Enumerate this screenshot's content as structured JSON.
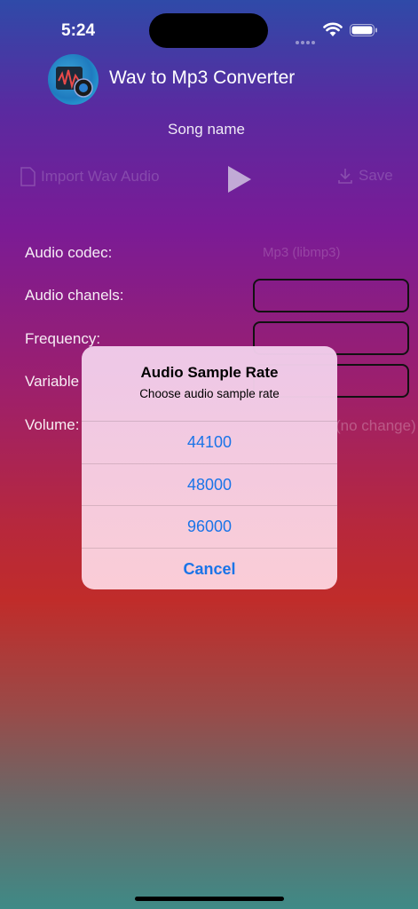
{
  "status": {
    "time": "5:24"
  },
  "header": {
    "title": "Wav to Mp3 Converter"
  },
  "song_name": "Song name",
  "toolbar": {
    "import_label": "Import Wav Audio",
    "save_label": "Save"
  },
  "settings": {
    "codec_label": "Audio codec:",
    "codec_value": "Mp3 (libmp3)",
    "channels_label": "Audio chanels:",
    "frequency_label": "Frequency:",
    "variable_label": "Variable",
    "volume_label": "Volume:",
    "volume_value": "(no change)"
  },
  "alert": {
    "title": "Audio Sample Rate",
    "message": "Choose audio sample rate",
    "options": [
      "44100",
      "48000",
      "96000"
    ],
    "cancel": "Cancel"
  },
  "colors": {
    "accent": "#1a74e8"
  }
}
